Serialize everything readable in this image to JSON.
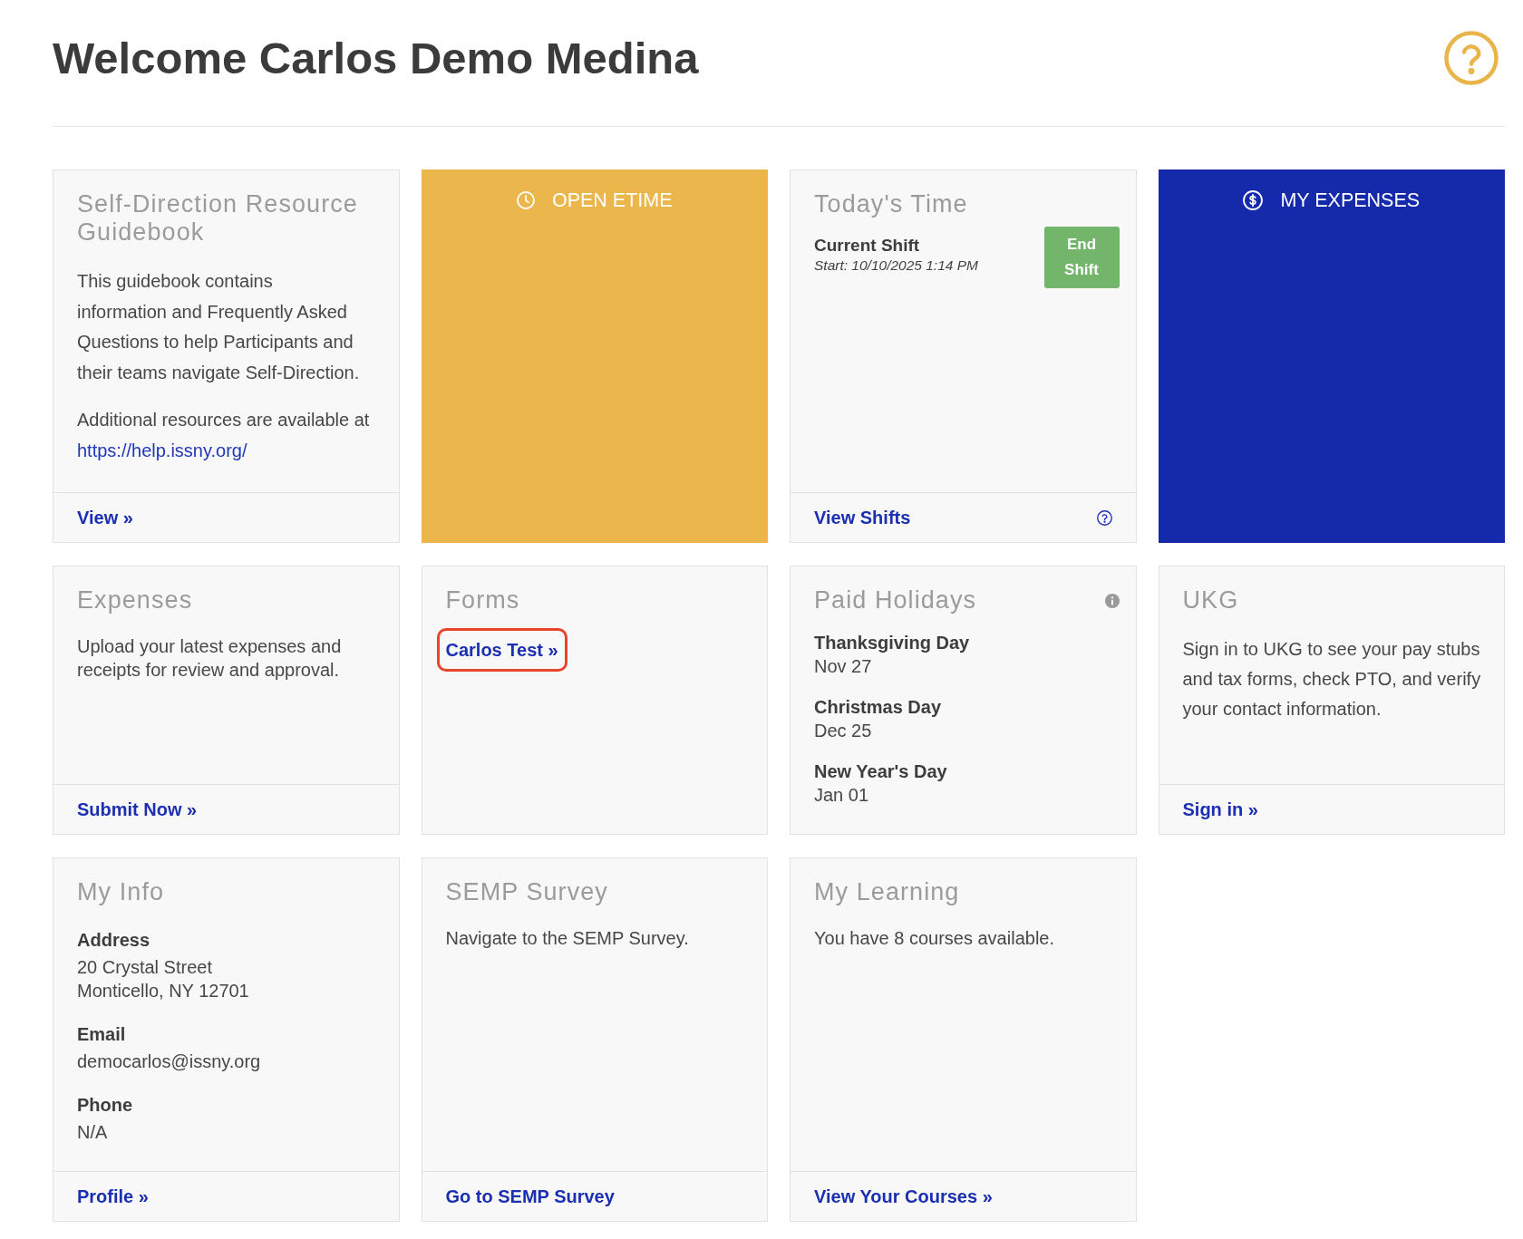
{
  "header": {
    "title": "Welcome Carlos Demo Medina"
  },
  "cards": [
    {
      "kind": "guide",
      "title": "Self-Direction Resource Guidebook",
      "paragraphs": [
        "This guidebook contains information and Frequently Asked Questions to help Participants and their teams navigate Self-Direction."
      ],
      "resources": {
        "text": "Additional resources are available at",
        "link": "https://help.issny.org/"
      },
      "footer_link": "View »"
    },
    {
      "kind": "etime",
      "color": "#ebb64b",
      "label": "OPEN ETIME"
    },
    {
      "kind": "time",
      "title": "Today's Time",
      "shift": {
        "label": "Current Shift",
        "start": "Start: 10/10/2025 1:14 PM",
        "button": "End Shift"
      },
      "footer_link": "View Shifts"
    },
    {
      "kind": "expenses",
      "color": "#152aab",
      "label": "MY EXPENSES"
    },
    {
      "kind": "text",
      "title": "Expenses",
      "text": "Upload your latest expenses and receipts for review and approval.",
      "footer_link": "Submit Now »"
    },
    {
      "kind": "forms",
      "title": "Forms",
      "links": [
        {
          "label": "Carlos Test »",
          "highlighted": true
        }
      ]
    },
    {
      "kind": "holidays",
      "title": "Paid Holidays",
      "holidays": [
        {
          "name": "Thanksgiving Day",
          "date": "Nov 27"
        },
        {
          "name": "Christmas Day",
          "date": "Dec 25"
        },
        {
          "name": "New Year's Day",
          "date": "Jan 01"
        }
      ]
    },
    {
      "kind": "prose",
      "title": "UKG",
      "text": "Sign in to UKG to see your pay stubs and tax forms, check PTO, and verify your contact information.",
      "footer_link": "Sign in »"
    },
    {
      "kind": "fields",
      "title": "My Info",
      "fields": [
        {
          "label": "Address",
          "lines": [
            "20 Crystal Street",
            "Monticello, NY 12701"
          ]
        },
        {
          "label": "Email",
          "lines": [
            "democarlos@issny.org"
          ]
        },
        {
          "label": "Phone",
          "lines": [
            "N/A"
          ]
        }
      ],
      "footer_link": "Profile »"
    },
    {
      "kind": "text",
      "title": "SEMP Survey",
      "text": "Navigate to the SEMP Survey.",
      "footer_link": "Go to SEMP Survey"
    },
    {
      "kind": "text",
      "title": "My Learning",
      "text": "You have 8 courses available.",
      "footer_link": "View Your Courses »"
    }
  ]
}
